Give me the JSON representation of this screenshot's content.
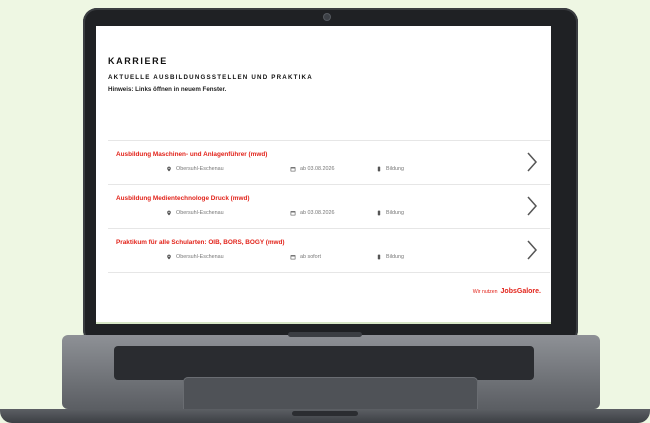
{
  "page": {
    "title": "KARRIERE",
    "subtitle": "AKTUELLE AUSBILDUNGSSTELLEN UND PRAKTIKA",
    "note": "Hinweis: Links öffnen in neuem Fenster."
  },
  "jobs": [
    {
      "title": "Ausbildung Maschinen- und Anlagenführer (mwd)",
      "location": "Obersuhl-Eschenau",
      "start": "ab 03.08.2026",
      "category": "Bildung"
    },
    {
      "title": "Ausbildung Medientechnologe Druck (mwd)",
      "location": "Obersuhl-Eschenau",
      "start": "ab 03.08.2026",
      "category": "Bildung"
    },
    {
      "title": "Praktikum für alle Schularten: OIB, BORS, BOGY (mwd)",
      "location": "Obersuhl-Eschenau",
      "start": "ab sofort",
      "category": "Bildung"
    }
  ],
  "footer": {
    "prefix": "Wir nutzen",
    "brand": "JobsGalore."
  },
  "colors": {
    "accent": "#e2231a",
    "background": "#eef7e3",
    "laptop": "#1f2124"
  },
  "icons": [
    "map-pin-icon",
    "calendar-icon",
    "category-icon",
    "chevron-right-icon",
    "camera-icon"
  ]
}
